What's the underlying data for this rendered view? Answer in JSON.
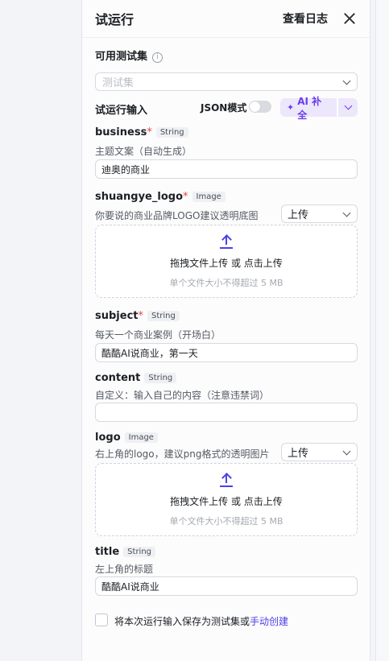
{
  "panel": {
    "title": "试运行",
    "view_log": "查看日志"
  },
  "testset": {
    "label": "可用测试集",
    "info_icon": "i",
    "placeholder": "测试集"
  },
  "run_input": {
    "label": "试运行输入",
    "json_mode_label": "JSON模式",
    "json_mode_on": false,
    "ai_button": "AI 补全",
    "ai_icon": "✦"
  },
  "fields": [
    {
      "name": "business",
      "required": "*",
      "type": "String",
      "desc": "主题文案（自动生成）",
      "value": "迪奥的商业"
    },
    {
      "name": "shuangye_logo",
      "required": "*",
      "type": "Image",
      "desc": "你要说的商业品牌LOGO建议透明底图",
      "mode": "上传",
      "drop_main": "拖拽文件上传 或 点击上传",
      "drop_sub": "单个文件大小不得超过 5 MB"
    },
    {
      "name": "subject",
      "required": "*",
      "type": "String",
      "desc": "每天一个商业案例（开场白）",
      "value": "酷酷AI说商业，第一天"
    },
    {
      "name": "content",
      "required": "",
      "type": "String",
      "desc": "自定义：输入自己的内容（注意违禁词）",
      "value": ""
    },
    {
      "name": "logo",
      "required": "",
      "type": "Image",
      "desc": "右上角的logo，建议png格式的透明图片",
      "mode": "上传",
      "drop_main": "拖拽文件上传 或 点击上传",
      "drop_sub": "单个文件大小不得超过 5 MB"
    },
    {
      "name": "title",
      "required": "",
      "type": "String",
      "desc": "左上角的标题",
      "value": "酷酷AI说商业"
    }
  ],
  "save": {
    "text": "将本次运行输入保存为测试集或",
    "link": "手动创建"
  },
  "colors": {
    "accent": "#4e40e5",
    "ai_purple": "#6b3df0",
    "required": "#e54545"
  }
}
